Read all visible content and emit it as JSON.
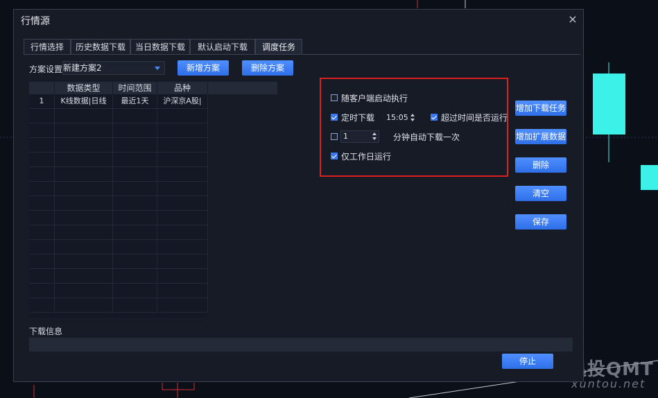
{
  "dialog": {
    "title": "行情源",
    "close_glyph": "×"
  },
  "tabs": [
    {
      "label": "行情选择",
      "active": false
    },
    {
      "label": "历史数据下载",
      "active": false
    },
    {
      "label": "当日数据下载",
      "active": false
    },
    {
      "label": "默认启动下载",
      "active": false
    },
    {
      "label": "调度任务",
      "active": true
    }
  ],
  "scheme": {
    "label": "方案设置",
    "selected": "新建方案2",
    "add_button": "新增方案",
    "delete_button": "删除方案"
  },
  "table": {
    "columns": [
      "",
      "数据类型",
      "时间范围",
      "品种"
    ],
    "rows": [
      [
        "1",
        "K线数据|日线",
        "最近1天",
        "沪深京A股|"
      ]
    ]
  },
  "options": {
    "run_with_client": {
      "label": "随客户端启动执行",
      "checked": false
    },
    "timed_download": {
      "label": "定时下载",
      "checked": true,
      "time": "15:05"
    },
    "run_if_overdue": {
      "label": "超过时间是否运行",
      "checked": true
    },
    "interval": {
      "checked": false,
      "value": "1",
      "suffix": "分钟自动下载一次"
    },
    "weekdays_only": {
      "label": "仅工作日运行",
      "checked": true
    }
  },
  "side_buttons": {
    "add_download_task": "增加下载任务",
    "add_extended_data": "增加扩展数据",
    "delete": "删除",
    "clear": "清空",
    "save": "保存"
  },
  "download_info": {
    "label": "下载信息",
    "stop_button": "停止"
  },
  "watermark": {
    "cn": "迅投QMT",
    "en": "xuntou.net"
  },
  "colors": {
    "accent": "#3b78f0",
    "highlight_box": "#e02020",
    "candle": "#3cf2e8",
    "background": "#0b0f17"
  }
}
